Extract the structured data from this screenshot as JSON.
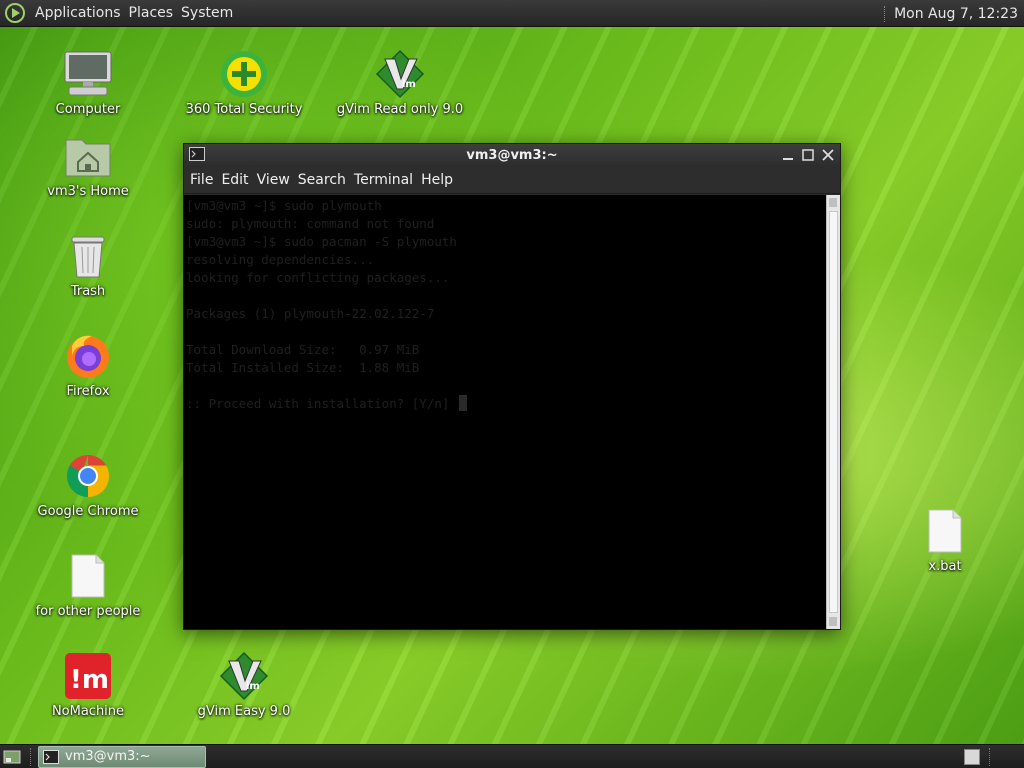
{
  "top_panel": {
    "menus": [
      "Applications",
      "Places",
      "System"
    ],
    "clock": "Mon Aug  7, 12:23"
  },
  "desktop_icons": [
    {
      "label": "Computer",
      "icon": "computer-icon"
    },
    {
      "label": "360 Total Security",
      "icon": "360-total-security-icon"
    },
    {
      "label": "gVim Read only 9.0",
      "icon": "gvim-icon"
    },
    {
      "label": "vm3's Home",
      "icon": "home-folder-icon"
    },
    {
      "label": "Trash",
      "icon": "trash-icon"
    },
    {
      "label": "Firefox",
      "icon": "firefox-icon"
    },
    {
      "label": "Google Chrome",
      "icon": "chrome-icon"
    },
    {
      "label": "for other people",
      "icon": "file-icon"
    },
    {
      "label": "NoMachine",
      "icon": "nomachine-icon"
    },
    {
      "label": "gVim Easy 9.0",
      "icon": "gvim-icon"
    },
    {
      "label": "x.bat",
      "icon": "file-icon"
    }
  ],
  "terminal": {
    "title": "vm3@vm3:~",
    "menu": [
      "File",
      "Edit",
      "View",
      "Search",
      "Terminal",
      "Help"
    ],
    "lines": [
      "[vm3@vm3 ~]$ sudo plymouth",
      "sudo: plymouth: command not found",
      "[vm3@vm3 ~]$ sudo pacman -S plymouth",
      "resolving dependencies...",
      "looking for conflicting packages...",
      "",
      "Packages (1) plymouth-22.02.122-7",
      "",
      "Total Download Size:   0.97 MiB",
      "Total Installed Size:  1.88 MiB",
      "",
      ":: Proceed with installation? [Y/n] "
    ]
  },
  "taskbar": {
    "task_label": "vm3@vm3:~"
  },
  "colors": {
    "panel": "#2b2b2b",
    "terminal_bg": "#000000",
    "terminal_text_dim": "#1f1f1f",
    "task_button": "#7f9984"
  }
}
